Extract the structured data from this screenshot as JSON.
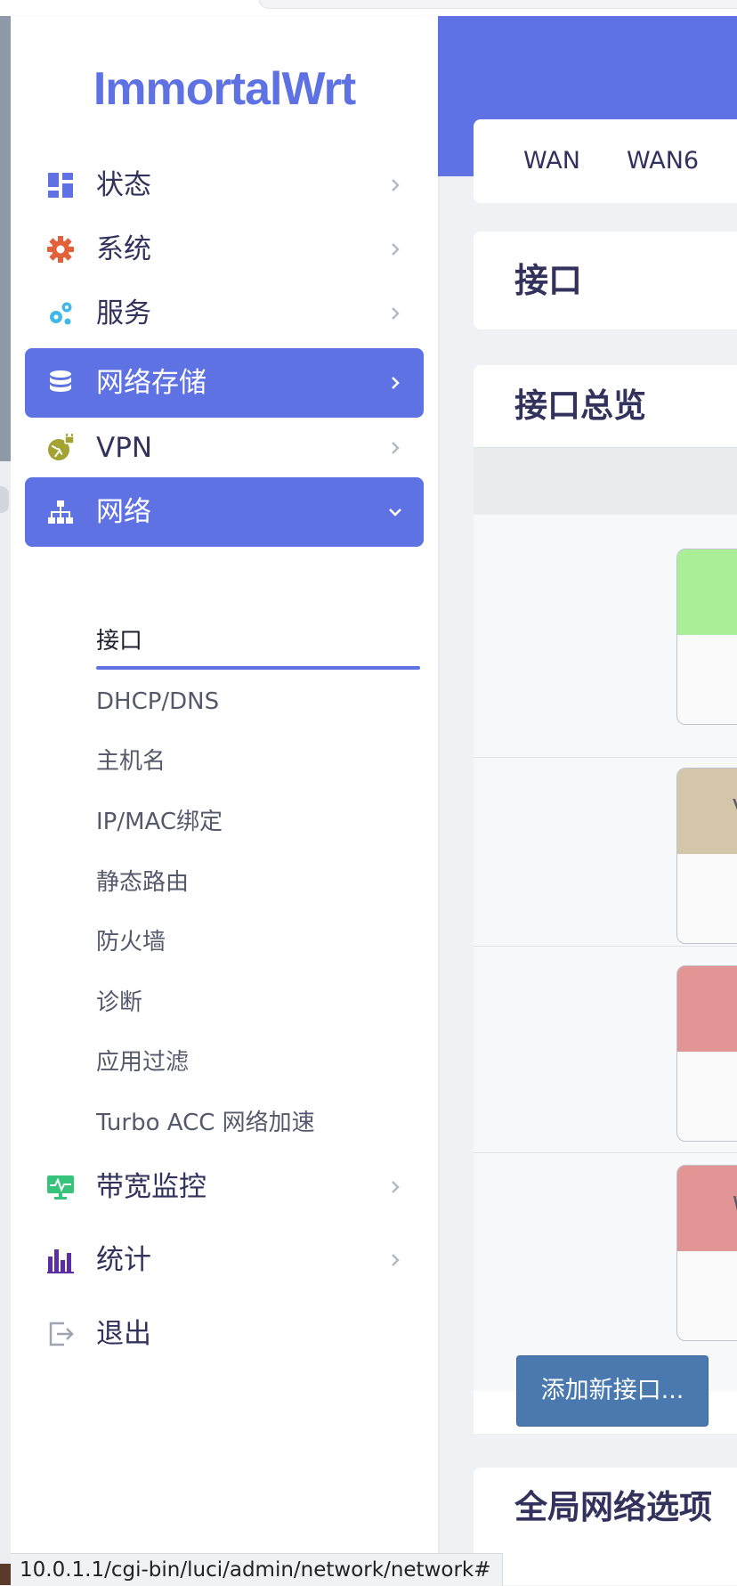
{
  "brand": {
    "logo_text": "ImmortalWrt",
    "accent": "#5e72e4"
  },
  "sidebar": {
    "items": [
      {
        "label": "状态",
        "icon": "dashboard-icon"
      },
      {
        "label": "系统",
        "icon": "gear-icon"
      },
      {
        "label": "服务",
        "icon": "gears-icon"
      },
      {
        "label": "网络存储",
        "icon": "database-icon",
        "active": true
      },
      {
        "label": "VPN",
        "icon": "globe-lock-icon"
      },
      {
        "label": "网络",
        "icon": "sitemap-icon",
        "active": true,
        "expanded": true
      },
      {
        "label": "带宽监控",
        "icon": "monitor-icon"
      },
      {
        "label": "统计",
        "icon": "bar-chart-icon"
      },
      {
        "label": "退出",
        "icon": "logout-icon"
      }
    ],
    "network_sub": [
      "接口",
      "DHCP/DNS",
      "主机名",
      "IP/MAC绑定",
      "静态路由",
      "防火墙",
      "诊断",
      "应用过滤",
      "Turbo ACC 网络加速"
    ]
  },
  "main": {
    "tabs": [
      "WAN",
      "WAN6"
    ],
    "page_title": "接口",
    "overview_title": "接口总览",
    "interface_badges": [
      {
        "color": "#aaef98",
        "letter": ""
      },
      {
        "color": "#d3c6a9",
        "letter": "V"
      },
      {
        "color": "#e29595",
        "letter": ""
      },
      {
        "color": "#e29595",
        "letter": "W"
      }
    ],
    "add_button": "添加新接口...",
    "global_title": "全局网络选项"
  },
  "statusbar": {
    "url": "10.0.1.1/cgi-bin/luci/admin/network/network#"
  }
}
